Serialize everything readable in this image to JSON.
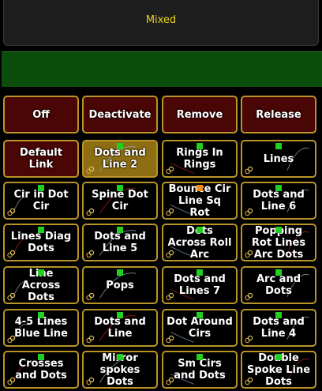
{
  "header": {
    "title": "Mixed"
  },
  "buttons": [
    {
      "label": "Off",
      "style": "red",
      "indicator": "none"
    },
    {
      "label": "Deactivate",
      "style": "red",
      "indicator": "none"
    },
    {
      "label": "Remove",
      "style": "red",
      "indicator": "none"
    },
    {
      "label": "Release",
      "style": "red",
      "indicator": "none"
    },
    {
      "label": "Default\nLink",
      "style": "red",
      "indicator": "none"
    },
    {
      "label": "Dots and\nLine 2",
      "style": "active",
      "indicator": "green"
    },
    {
      "label": "Rings In\nRings",
      "style": "normal",
      "indicator": "green"
    },
    {
      "label": "Lines",
      "style": "normal",
      "indicator": "green"
    },
    {
      "label": "Cir in Dot\nCir",
      "style": "normal",
      "indicator": "green"
    },
    {
      "label": "Spine Dot\nCir",
      "style": "normal",
      "indicator": "green"
    },
    {
      "label": "Bounce Cir\nLine Sq\nRot",
      "style": "normal",
      "indicator": "orange"
    },
    {
      "label": "Dots and\nLine 6",
      "style": "normal",
      "indicator": "green"
    },
    {
      "label": "Lines Diag\nDots",
      "style": "normal",
      "indicator": "green"
    },
    {
      "label": "Dots and\nLine 5",
      "style": "normal",
      "indicator": "green"
    },
    {
      "label": "Dots\nAcross Roll\nArc",
      "style": "normal",
      "indicator": "green"
    },
    {
      "label": "Popping\nRot Lines\nArc Dots",
      "style": "normal",
      "indicator": "green"
    },
    {
      "label": "Line\nAcross\nDots",
      "style": "normal",
      "indicator": "green"
    },
    {
      "label": "Pops",
      "style": "normal",
      "indicator": "green"
    },
    {
      "label": "Dots and\nLines 7",
      "style": "normal",
      "indicator": "green"
    },
    {
      "label": "Arc and\nDots",
      "style": "normal",
      "indicator": "green"
    },
    {
      "label": "4-5 Lines\nBlue Line",
      "style": "normal",
      "indicator": "green"
    },
    {
      "label": "Dots and\nLine",
      "style": "normal",
      "indicator": "green"
    },
    {
      "label": "Dot Around\nCirs",
      "style": "normal",
      "indicator": "green"
    },
    {
      "label": "Dots and\nLine 4",
      "style": "normal",
      "indicator": "green"
    },
    {
      "label": "Crosses\nand Dots",
      "style": "normal",
      "indicator": "green"
    },
    {
      "label": "Mirror\nspokes\nDots",
      "style": "normal",
      "indicator": "green"
    },
    {
      "label": "Sm Cirs\nand Dots",
      "style": "normal",
      "indicator": "green"
    },
    {
      "label": "Double\nSpoke Line\nDots",
      "style": "normal",
      "indicator": "green"
    }
  ],
  "colors": {
    "accent": "#e6d21e",
    "border": "#b89428",
    "active": "#8e6e12",
    "red": "#4a0505",
    "indicator": "#22d022",
    "green_bar": "#0b4d0b"
  }
}
